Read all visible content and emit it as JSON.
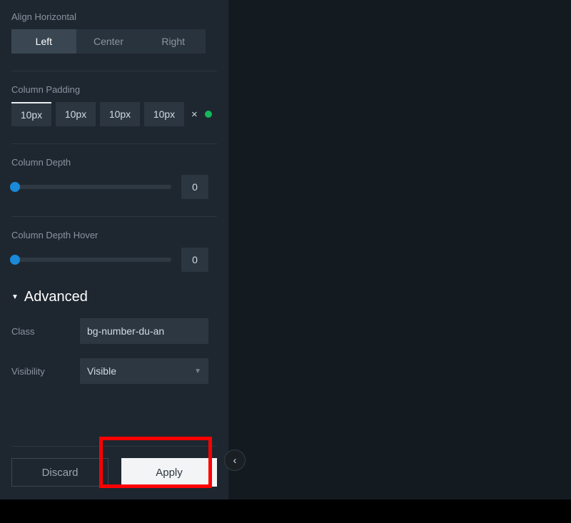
{
  "align_horizontal": {
    "label": "Align Horizontal",
    "options": [
      "Left",
      "Center",
      "Right"
    ],
    "active": "Left"
  },
  "column_padding": {
    "label": "Column Padding",
    "values": [
      "10px",
      "10px",
      "10px",
      "10px"
    ],
    "linked_indicator": "green"
  },
  "column_depth": {
    "label": "Column Depth",
    "value": "0"
  },
  "column_depth_hover": {
    "label": "Column Depth Hover",
    "value": "0"
  },
  "advanced": {
    "title": "Advanced",
    "expanded": true
  },
  "class_field": {
    "label": "Class",
    "value": "bg-number-du-an"
  },
  "visibility_field": {
    "label": "Visibility",
    "value": "Visible"
  },
  "buttons": {
    "discard": "Discard",
    "apply": "Apply"
  },
  "icons": {
    "close": "×",
    "chevron_left": "‹",
    "caret_down": "▼",
    "triangle_down": "▼"
  }
}
